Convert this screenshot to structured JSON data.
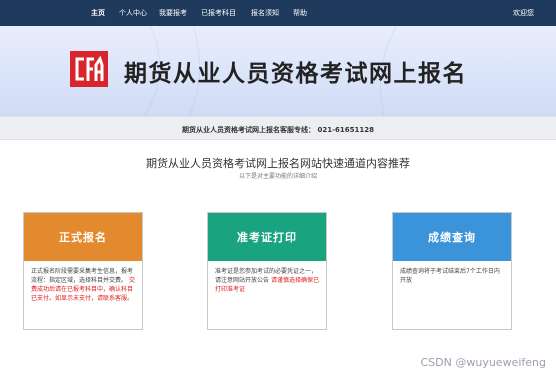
{
  "nav": {
    "items": [
      {
        "label": "主页",
        "active": true
      },
      {
        "label": "个人中心",
        "active": false
      },
      {
        "label": "我要报考",
        "active": false
      },
      {
        "label": "已报考科目",
        "active": false
      },
      {
        "label": "报名须知",
        "active": false
      },
      {
        "label": "帮助",
        "active": false
      }
    ],
    "welcome": "欢迎您"
  },
  "banner": {
    "logo_icon": "cfa-logo-icon",
    "title": "期货从业人员资格考试网上报名"
  },
  "hotline": "期货从业人员资格考试网上报名客服专线： 021-61651128",
  "section": {
    "title": "期货从业人员资格考试网上报名网站快速通道内容推荐",
    "subtitle": "以下是对主要功能的详细介绍"
  },
  "cards": [
    {
      "title": "正式报名",
      "color": "#e48a2e",
      "text": "正式报名阶段需要采集考生信息，报考流程：指定区域，选择科目并交费。",
      "warning": "交费成功后请在已报考科目中，确认科目已支付。如显示未支付，请联系客服。"
    },
    {
      "title": "准考证打印",
      "color": "#1aa380",
      "text": "准考证是您参加考试的必要凭证之一，请注意网站开放公告",
      "warning": "请谨慎选择确保已打印准考证"
    },
    {
      "title": "成绩查询",
      "color": "#3b94d9",
      "text": "成绩查询将于考试结束后7个工作日内开放",
      "warning": ""
    }
  ],
  "watermark": "CSDN @wuyueweifeng"
}
